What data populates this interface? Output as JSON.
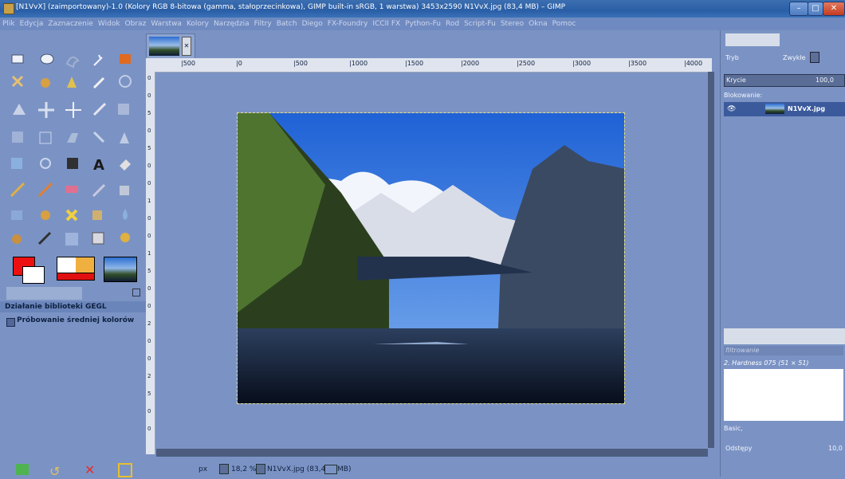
{
  "window": {
    "title": "[N1VvX] (zaimportowany)-1.0 (Kolory RGB 8-bitowa (gamma, stałoprzecinkowa), GIMP built-in sRGB, 1 warstwa) 3453x2590 N1VvX.jpg (83,4 MB) – GIMP"
  },
  "menu": [
    "Plik",
    "Edycja",
    "Zaznaczenie",
    "Widok",
    "Obraz",
    "Warstwa",
    "Kolory",
    "Narzędzia",
    "Filtry",
    "Batch",
    "Diego",
    "FX-Foundry",
    "ICCII FX",
    "Python-Fu",
    "Rod",
    "Script-Fu",
    "Stereo",
    "Okna",
    "Pomoc"
  ],
  "ruler": {
    "h_labels": [
      "|500",
      "|0",
      "|500",
      "|1000",
      "|1500",
      "|2000",
      "|2500",
      "|3000",
      "|3500",
      "|4000"
    ],
    "v_labels": [
      "0",
      "0",
      "5",
      "0",
      "5",
      "0",
      "0",
      "1",
      "0",
      "0",
      "1",
      "5",
      "0",
      "0",
      "2",
      "0",
      "0",
      "2",
      "5",
      "0",
      "0"
    ]
  },
  "tool_options": {
    "heading": "Działanie biblioteki GEGL",
    "sample_label": "Próbowanie średniej kolorów"
  },
  "status": {
    "unit": "px",
    "zoom": "18,2 %",
    "file": "N1VvX.jpg (83,4",
    "file_tail": "MB)"
  },
  "layers": {
    "mode_label": "Tryb",
    "mode_value": "Zwykłe",
    "opacity_label": "Krycie",
    "opacity_value": "100,0",
    "lock_label": "Blokowanie:",
    "layer_name": "N1VvX.jpg"
  },
  "brushes": {
    "filter_placeholder": "filtrowanie",
    "brush_name": "2. Hardness 075 (51 × 51)",
    "preset": "Basic,",
    "spacing_label": "Odstępy",
    "spacing_value": "10,0"
  },
  "colors": {
    "fg": "#ee1010",
    "bg": "#ffffff",
    "accent": "#2a5ea6"
  }
}
